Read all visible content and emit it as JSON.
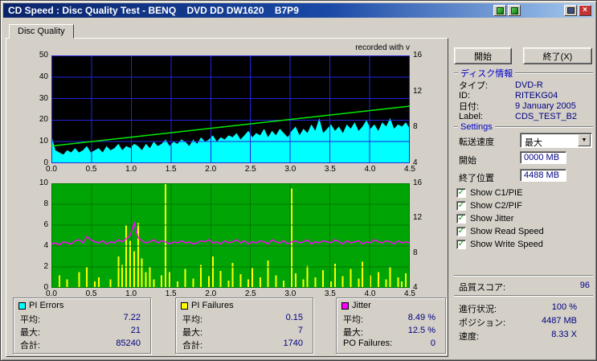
{
  "window": {
    "title": "CD Speed : Disc Quality Test - BENQ    DVD DD DW1620    B7P9"
  },
  "tab": {
    "label": "Disc Quality"
  },
  "chart_note": "recorded with  v",
  "chart_data": [
    {
      "type": "area",
      "title": "PI Errors / Write Speed",
      "bg": "#000000",
      "grid": "#2424e0",
      "x_unit": "GB",
      "x_range": [
        0,
        4.5
      ],
      "x_ticks": [
        "0.0",
        "0.5",
        "1.0",
        "1.5",
        "2.0",
        "2.5",
        "3.0",
        "3.5",
        "4.0",
        "4.5"
      ],
      "left_axis": {
        "range": [
          0,
          50
        ],
        "ticks": [
          0,
          10,
          20,
          30,
          40,
          50
        ]
      },
      "right_axis": {
        "range": [
          4,
          16
        ],
        "ticks": [
          4,
          8,
          12,
          16
        ]
      },
      "series": [
        {
          "name": "PI Errors",
          "type": "area",
          "color": "#00ffff",
          "values": [
            13,
            6,
            5,
            4,
            6,
            5,
            7,
            5,
            6,
            8,
            5,
            6,
            7,
            5,
            8,
            6,
            7,
            9,
            6,
            8,
            7,
            9,
            8,
            6,
            9,
            7,
            10,
            8,
            9,
            11,
            8,
            10,
            9,
            11,
            10,
            8,
            11,
            9,
            12,
            10,
            11,
            13,
            10,
            12,
            11,
            13,
            12,
            14,
            11,
            13,
            15,
            12,
            14,
            13,
            16,
            12,
            15,
            13,
            16,
            14,
            12,
            15,
            17,
            13,
            16,
            14,
            18,
            15,
            21,
            14,
            16,
            18,
            15,
            17,
            14,
            18,
            16,
            19,
            15,
            17,
            20,
            16,
            18,
            15,
            19,
            17,
            21,
            16,
            18,
            17,
            19,
            16
          ]
        },
        {
          "name": "Write Speed",
          "type": "line",
          "color": "#00ee00",
          "endpoints": [
            8,
            26.5
          ]
        }
      ]
    },
    {
      "type": "bar+line",
      "title": "PI Failures / Jitter",
      "bg": "#00a404",
      "grid": "#007a00",
      "x_unit": "GB",
      "x_range": [
        0,
        4.5
      ],
      "x_ticks": [
        "0.0",
        "0.5",
        "1.0",
        "1.5",
        "2.0",
        "2.5",
        "3.0",
        "3.5",
        "4.0",
        "4.5"
      ],
      "left_axis": {
        "range": [
          0,
          10
        ],
        "ticks": [
          0,
          2,
          4,
          6,
          8,
          10
        ]
      },
      "right_axis": {
        "range": [
          4,
          16
        ],
        "ticks": [
          4,
          8,
          12,
          16
        ]
      },
      "series": [
        {
          "name": "PI Failures",
          "type": "bars",
          "color": "#ffff00",
          "values": [
            0,
            0,
            1.2,
            0,
            0.8,
            0,
            0,
            1.5,
            0,
            2.0,
            0,
            0.6,
            1.0,
            0,
            0,
            0.8,
            0,
            3.0,
            2.2,
            6.0,
            4.5,
            3.5,
            6.2,
            2.8,
            1.5,
            2.0,
            0.8,
            0,
            1.2,
            10.0,
            1.5,
            0,
            0.6,
            0,
            1.8,
            0,
            0.9,
            0,
            2.2,
            0,
            1.1,
            3.0,
            0,
            1.6,
            0,
            0.7,
            2.4,
            0,
            1.3,
            0,
            0.8,
            1.9,
            0,
            1.0,
            0,
            2.6,
            0,
            1.2,
            0,
            0.7,
            0,
            9.5,
            1.4,
            0,
            0.8,
            2.1,
            0,
            1.0,
            0,
            1.7,
            0,
            0.6,
            2.3,
            0,
            1.1,
            0,
            1.8,
            0,
            0.9,
            2.5,
            0,
            1.2,
            0,
            1.5,
            0,
            0.8,
            2.0,
            0,
            1.0,
            0.6,
            1.4,
            0
          ]
        },
        {
          "name": "Jitter",
          "type": "line",
          "color": "#ff00ff",
          "values": [
            4.2,
            4.3,
            4.1,
            4.4,
            4.3,
            4.2,
            4.5,
            4.6,
            4.3,
            4.9,
            4.6,
            4.4,
            4.3,
            4.5,
            4.2,
            4.4,
            4.3,
            4.6,
            4.4,
            4.7,
            5.0,
            6.2,
            4.8,
            4.5,
            4.3,
            4.4,
            4.6,
            4.3,
            4.5,
            4.4,
            4.2,
            4.4,
            4.3,
            4.5,
            4.3,
            4.4,
            4.2,
            4.3,
            4.5,
            4.4,
            4.6,
            4.3,
            4.4,
            4.2,
            4.5,
            4.3,
            4.4,
            4.6,
            4.3,
            4.5,
            4.2,
            4.4,
            4.3,
            4.5,
            4.4,
            4.2,
            4.6,
            4.4,
            4.3,
            4.5,
            4.2,
            4.4,
            4.5,
            4.3,
            4.4,
            4.6,
            4.2,
            4.4,
            4.3,
            4.5,
            4.4,
            4.3,
            4.6,
            4.4,
            4.2,
            4.5,
            4.3,
            4.4,
            4.5,
            4.2,
            4.4,
            4.3,
            4.6,
            4.4,
            4.3,
            4.5,
            4.4,
            4.2,
            4.5,
            4.3,
            4.4,
            4.3
          ]
        }
      ]
    }
  ],
  "legend": [
    {
      "title": "PI Errors",
      "color": "#00ffff",
      "rows": [
        [
          "平均:",
          "7.22"
        ],
        [
          "最大:",
          "21"
        ],
        [
          "合計:",
          "85240"
        ]
      ]
    },
    {
      "title": "PI Failures",
      "color": "#ffff00",
      "rows": [
        [
          "平均:",
          "0.15"
        ],
        [
          "最大:",
          "7"
        ],
        [
          "合計:",
          "1740"
        ]
      ]
    },
    {
      "title": "Jitter",
      "color": "#ff00ff",
      "rows": [
        [
          "平均:",
          "8.49 %"
        ],
        [
          "最大:",
          "12.5 %"
        ],
        [
          "PO Failures:",
          "0"
        ]
      ]
    }
  ],
  "panel": {
    "start_button": "開始",
    "exit_button": "終了(X)",
    "disc_info": {
      "title": "ディスク情報",
      "rows": [
        [
          "タイプ:",
          "DVD-R"
        ],
        [
          "ID:",
          "RITEKG04"
        ],
        [
          "日付:",
          "9 January 2005"
        ],
        [
          "Label:",
          "CDS_TEST_B2"
        ]
      ]
    },
    "settings": {
      "title": "Settings",
      "transfer_label": "転送速度",
      "transfer_value": "最大",
      "start_label": "開始",
      "start_value": "0000 MB",
      "end_label": "終了位置",
      "end_value": "4488 MB",
      "checkboxes": [
        {
          "label": "Show C1/PIE",
          "checked": true
        },
        {
          "label": "Show C2/PIF",
          "checked": true
        },
        {
          "label": "Show Jitter",
          "checked": true
        },
        {
          "label": "Show Read Speed",
          "checked": true
        },
        {
          "label": "Show Write Speed",
          "checked": true
        }
      ]
    },
    "quality": {
      "label": "品質スコア:",
      "value": "96"
    },
    "status": [
      [
        "進行状況:",
        "100 %"
      ],
      [
        "ポジション:",
        "4487 MB"
      ],
      [
        "速度:",
        "8.33 X"
      ]
    ]
  }
}
